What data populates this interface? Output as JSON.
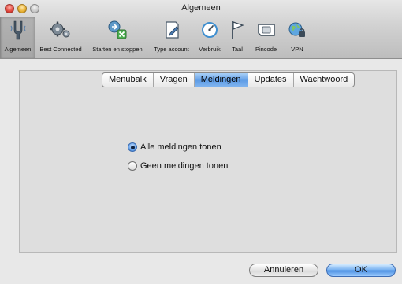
{
  "window": {
    "title": "Algemeen"
  },
  "toolbar": {
    "items": [
      {
        "label": "Algemeen",
        "icon": "tuning-fork-icon",
        "selected": true
      },
      {
        "label": "Best Connected",
        "icon": "gears-icon"
      },
      {
        "label": "Starten en stoppen",
        "icon": "start-stop-icon"
      },
      {
        "label": "Type account",
        "icon": "document-edit-icon"
      },
      {
        "label": "Verbruik",
        "icon": "gauge-icon"
      },
      {
        "label": "Taal",
        "icon": "flag-icon"
      },
      {
        "label": "Pincode",
        "icon": "sim-card-icon"
      },
      {
        "label": "VPN",
        "icon": "globe-lock-icon"
      }
    ]
  },
  "tabs": [
    {
      "label": "Menubalk"
    },
    {
      "label": "Vragen"
    },
    {
      "label": "Meldingen",
      "active": true
    },
    {
      "label": "Updates"
    },
    {
      "label": "Wachtwoord"
    }
  ],
  "notifications": {
    "options": [
      {
        "label": "Alle meldingen tonen",
        "checked": true
      },
      {
        "label": "Geen meldingen tonen",
        "checked": false
      }
    ]
  },
  "buttons": {
    "cancel": "Annuleren",
    "ok": "OK"
  },
  "colors": {
    "accent": "#5f9de6",
    "close": "#e0443a",
    "minimize": "#e8b132"
  }
}
